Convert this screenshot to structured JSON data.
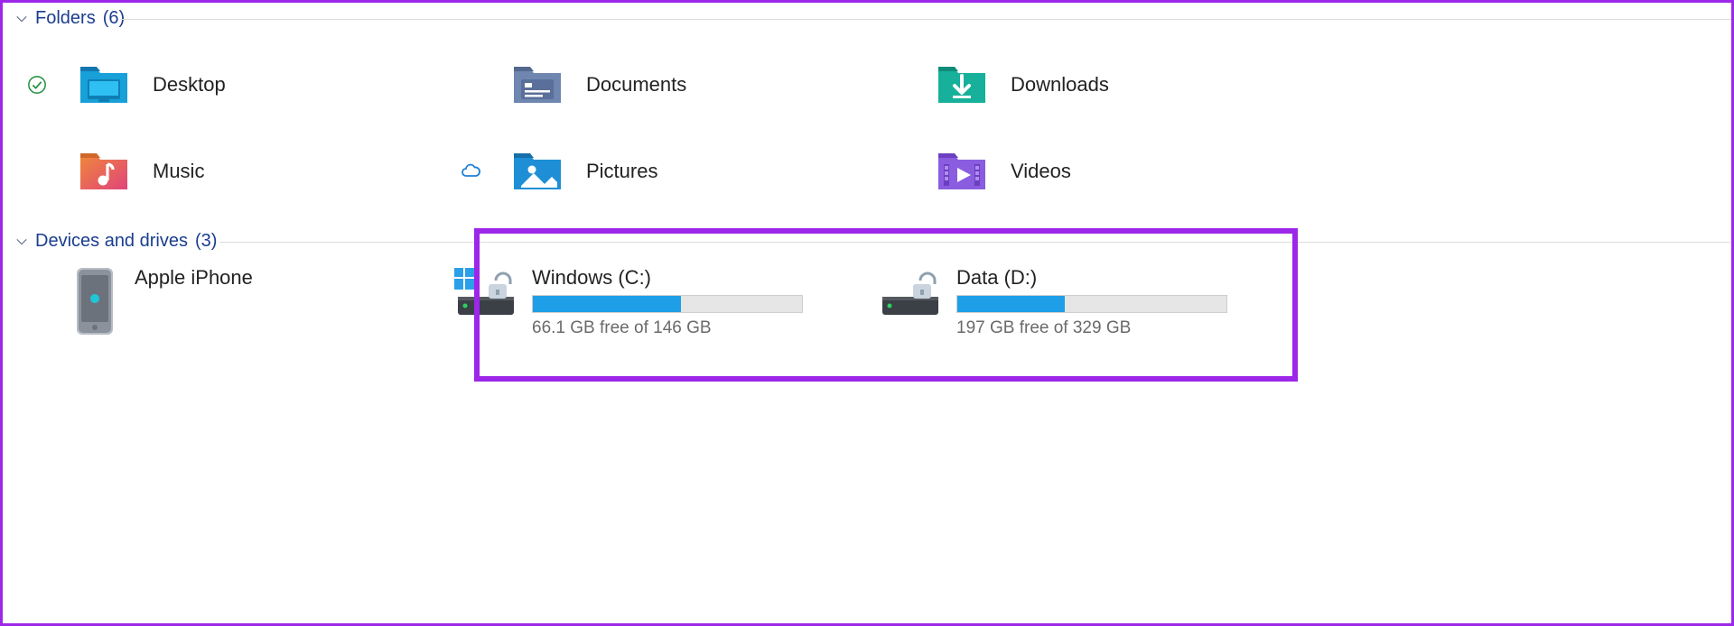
{
  "sections": {
    "folders": {
      "title": "Folders",
      "count_suffix": "(6)"
    },
    "drives": {
      "title": "Devices and drives",
      "count_suffix": "(3)"
    }
  },
  "folders": {
    "desktop": {
      "label": "Desktop",
      "status": "synced"
    },
    "documents": {
      "label": "Documents"
    },
    "downloads": {
      "label": "Downloads"
    },
    "music": {
      "label": "Music"
    },
    "pictures": {
      "label": "Pictures",
      "status": "cloud"
    },
    "videos": {
      "label": "Videos"
    }
  },
  "devices": {
    "iphone": {
      "label": "Apple iPhone"
    }
  },
  "drives": {
    "c": {
      "name": "Windows (C:)",
      "free_text": "66.1 GB free of 146 GB",
      "used_percent": 55
    },
    "d": {
      "name": "Data (D:)",
      "free_text": "197 GB free of 329 GB",
      "used_percent": 40
    }
  }
}
